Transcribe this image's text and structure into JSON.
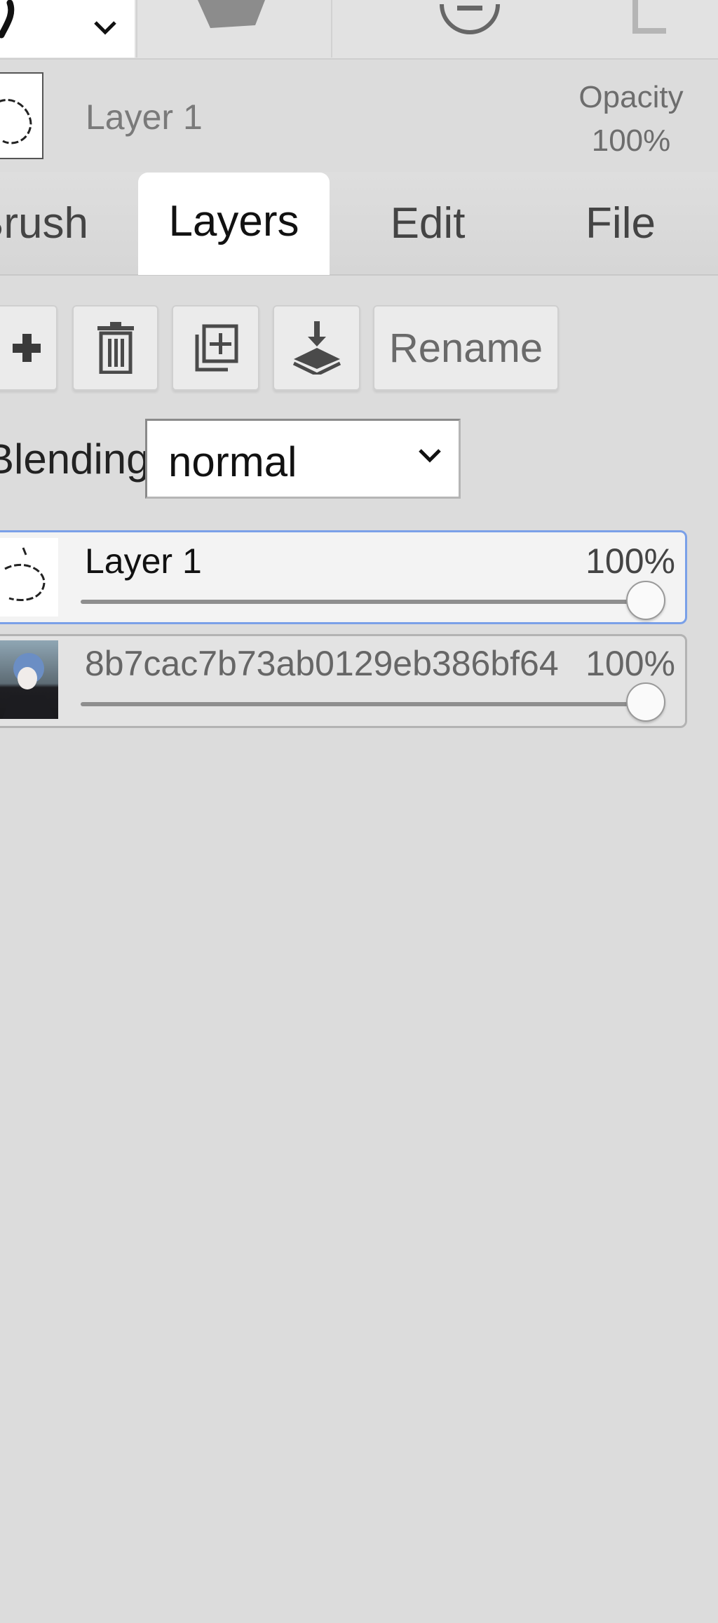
{
  "layer_info": {
    "name": "Layer 1",
    "opacity_label": "Opacity",
    "opacity_value": "100%"
  },
  "tabs": [
    {
      "label": "Brush",
      "active": false
    },
    {
      "label": "Layers",
      "active": true
    },
    {
      "label": "Edit",
      "active": false
    },
    {
      "label": "File",
      "active": false
    }
  ],
  "actions": {
    "add_icon": "plus-icon",
    "delete_icon": "trash-icon",
    "duplicate_icon": "duplicate-icon",
    "merge_icon": "merge-down-icon",
    "rename_label": "Rename"
  },
  "blending": {
    "label": "Blending",
    "value": "normal"
  },
  "layers": [
    {
      "name": "Layer 1",
      "opacity": "100%",
      "opacity_fraction": 1.0,
      "selected": true
    },
    {
      "name": "8b7cac7b73ab0129eb386bf64",
      "opacity": "100%",
      "opacity_fraction": 1.0,
      "selected": false
    }
  ],
  "colors": {
    "panel_bg": "#dcdcdc",
    "selected_border": "#7aa0e8"
  }
}
